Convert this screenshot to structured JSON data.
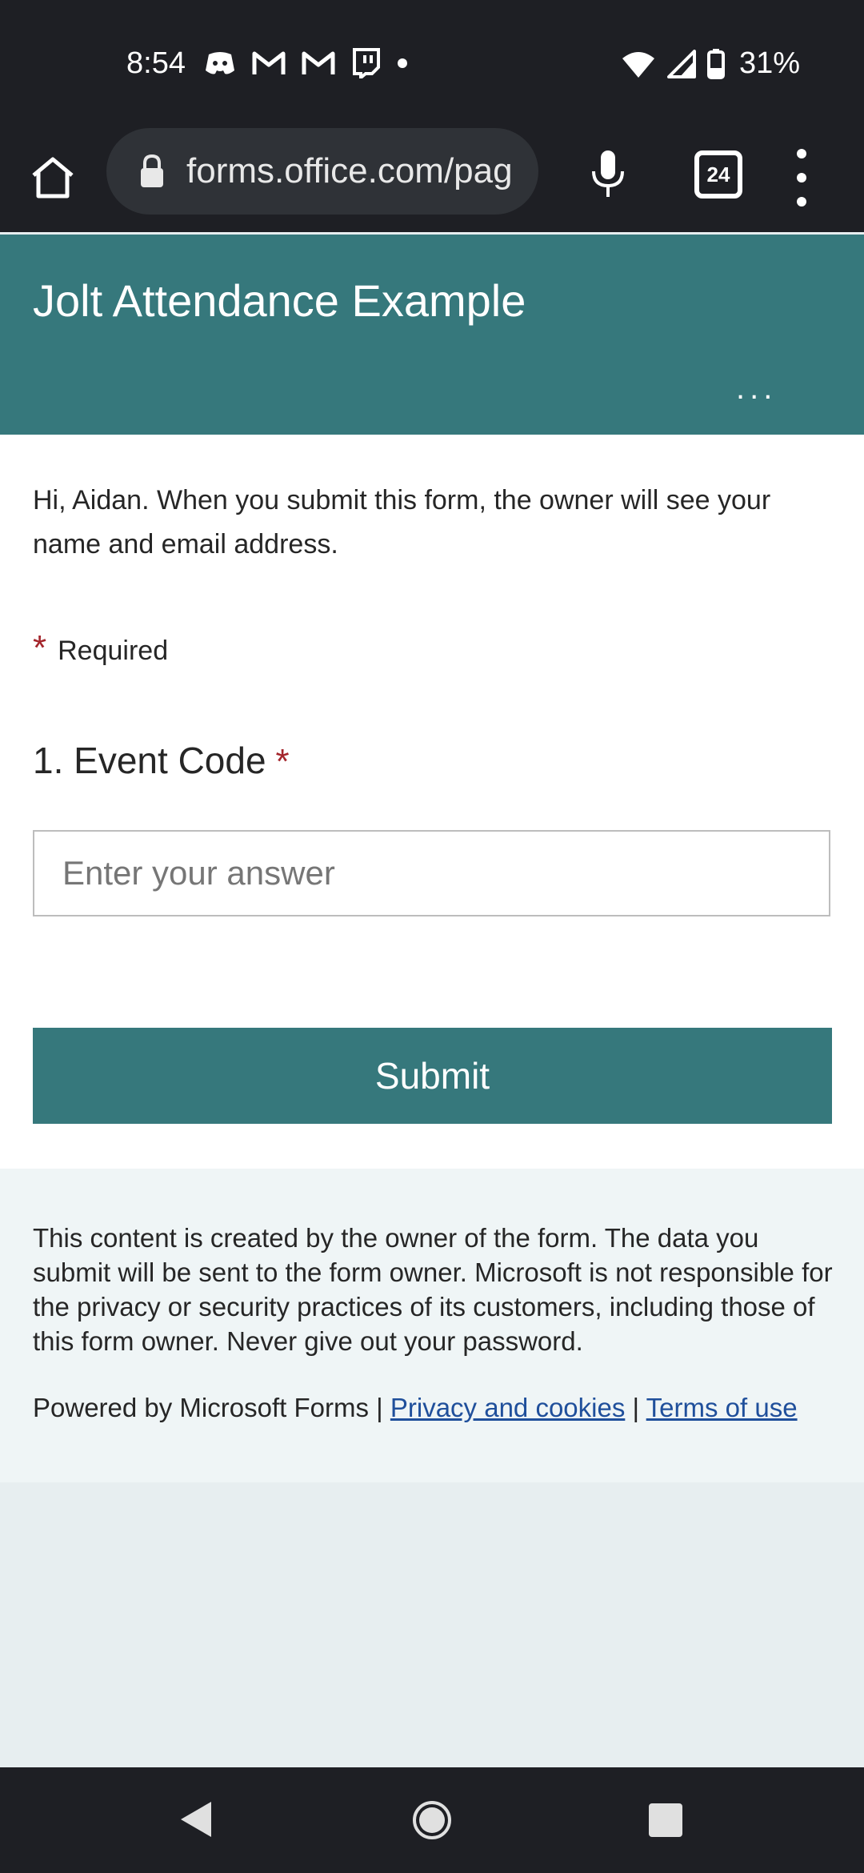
{
  "status_bar": {
    "time": "8:54",
    "battery_percent": "31%",
    "notification_icons": [
      "discord-icon",
      "gmail-icon",
      "gmail-icon",
      "twitch-icon",
      "dot-icon"
    ],
    "system_icons": [
      "wifi-icon",
      "signal-icon",
      "battery-icon"
    ]
  },
  "browser": {
    "url": "forms.office.com/pag",
    "tab_count": "24"
  },
  "form": {
    "title": "Jolt Attendance Example",
    "more_label": "...",
    "intro": "Hi, Aidan. When you submit this form, the owner will see your name and email address.",
    "required_star": "*",
    "required_label": "Required",
    "question": {
      "number": "1.",
      "label": "Event Code",
      "star": "*",
      "placeholder": "Enter your answer"
    },
    "submit_label": "Submit"
  },
  "footer": {
    "disclaimer": "This content is created by the owner of the form. The data you submit will be sent to the form owner. Microsoft is not responsible for the privacy or security practices of its customers, including those of this form owner. Never give out your password.",
    "powered_by": "Powered by Microsoft Forms |",
    "privacy_link": "Privacy and cookies",
    "separator": "|",
    "terms_link": "Terms of use"
  },
  "colors": {
    "header_bg": "#36787c",
    "submit_bg": "#36787c",
    "required_star": "#a4262c",
    "link": "#1f4f9b",
    "chrome_bg": "#1e1f24"
  }
}
